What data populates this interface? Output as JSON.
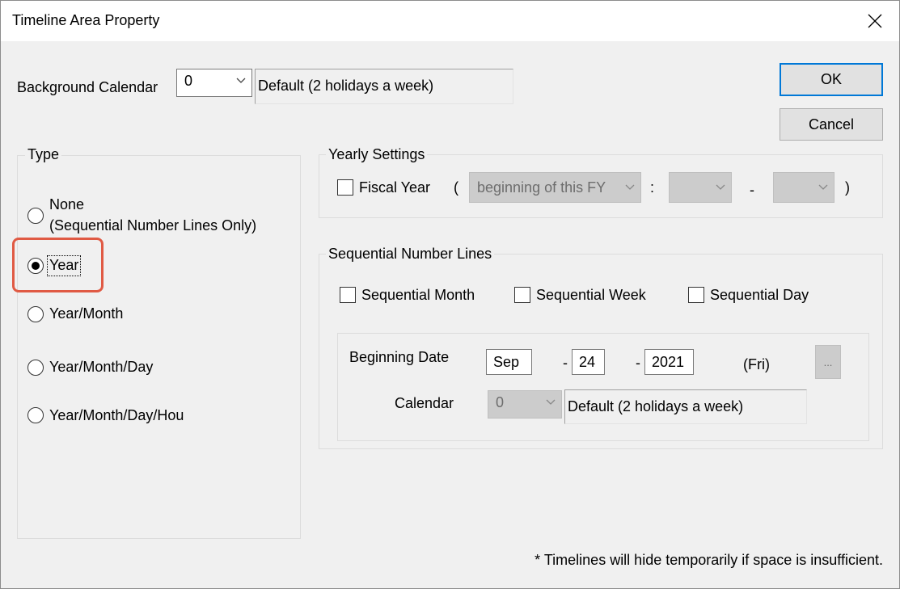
{
  "window": {
    "title": "Timeline Area Property"
  },
  "background_calendar": {
    "label": "Background Calendar",
    "value": "0",
    "description": "Default (2 holidays a week)"
  },
  "buttons": {
    "ok": "OK",
    "cancel": "Cancel"
  },
  "type_group": {
    "title": "Type",
    "options": [
      {
        "label_line1": "None",
        "label_line2": "(Sequential Number Lines Only)",
        "selected": false
      },
      {
        "label": "Year",
        "selected": true
      },
      {
        "label": "Year/Month",
        "selected": false
      },
      {
        "label": "Year/Month/Day",
        "selected": false
      },
      {
        "label": "Year/Month/Day/Hou",
        "selected": false
      }
    ]
  },
  "yearly_settings": {
    "title": "Yearly Settings",
    "fiscal_year_label": "Fiscal Year",
    "open_paren": "(",
    "fy_start_value": "beginning of this FY",
    "colon": ":",
    "dash": "-",
    "close_paren": ")"
  },
  "sequential": {
    "title": "Sequential Number Lines",
    "month_label": "Sequential Month",
    "week_label": "Sequential Week",
    "day_label": "Sequential Day",
    "beginning_date_label": "Beginning Date",
    "month_value": "Sep",
    "dash": "-",
    "day_value": "24",
    "year_value": "2021",
    "weekday": "(Fri)",
    "ellipsis": "...",
    "calendar_label": "Calendar",
    "calendar_value": "0",
    "calendar_description": "Default (2 holidays a week)"
  },
  "footnote": "* Timelines will hide temporarily if space is insufficient.",
  "colors": {
    "accent": "#0078d7",
    "highlight": "#e05a44",
    "background": "#f0f0f0"
  }
}
